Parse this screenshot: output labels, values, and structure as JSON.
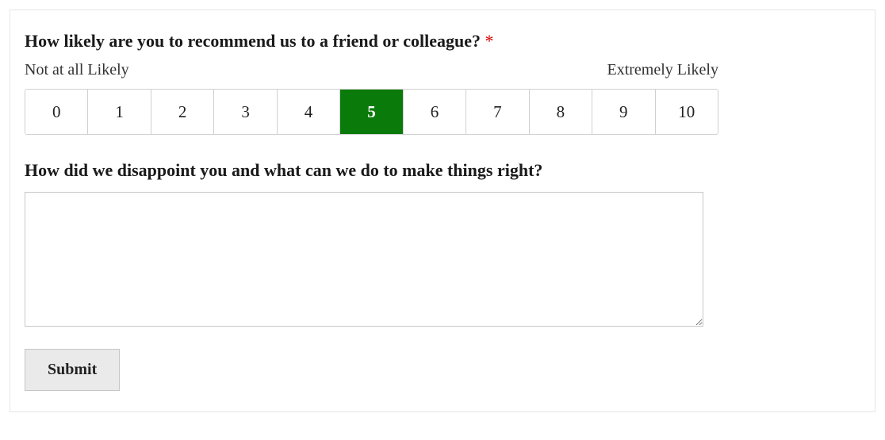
{
  "question1": {
    "label": "How likely are you to recommend us to a friend or colleague?",
    "required_marker": "*",
    "low_label": "Not at all Likely",
    "high_label": "Extremely Likely",
    "options": [
      "0",
      "1",
      "2",
      "3",
      "4",
      "5",
      "6",
      "7",
      "8",
      "9",
      "10"
    ],
    "selected_index": 5
  },
  "question2": {
    "label": "How did we disappoint you and what can we do to make things right?",
    "value": ""
  },
  "submit_label": "Submit"
}
